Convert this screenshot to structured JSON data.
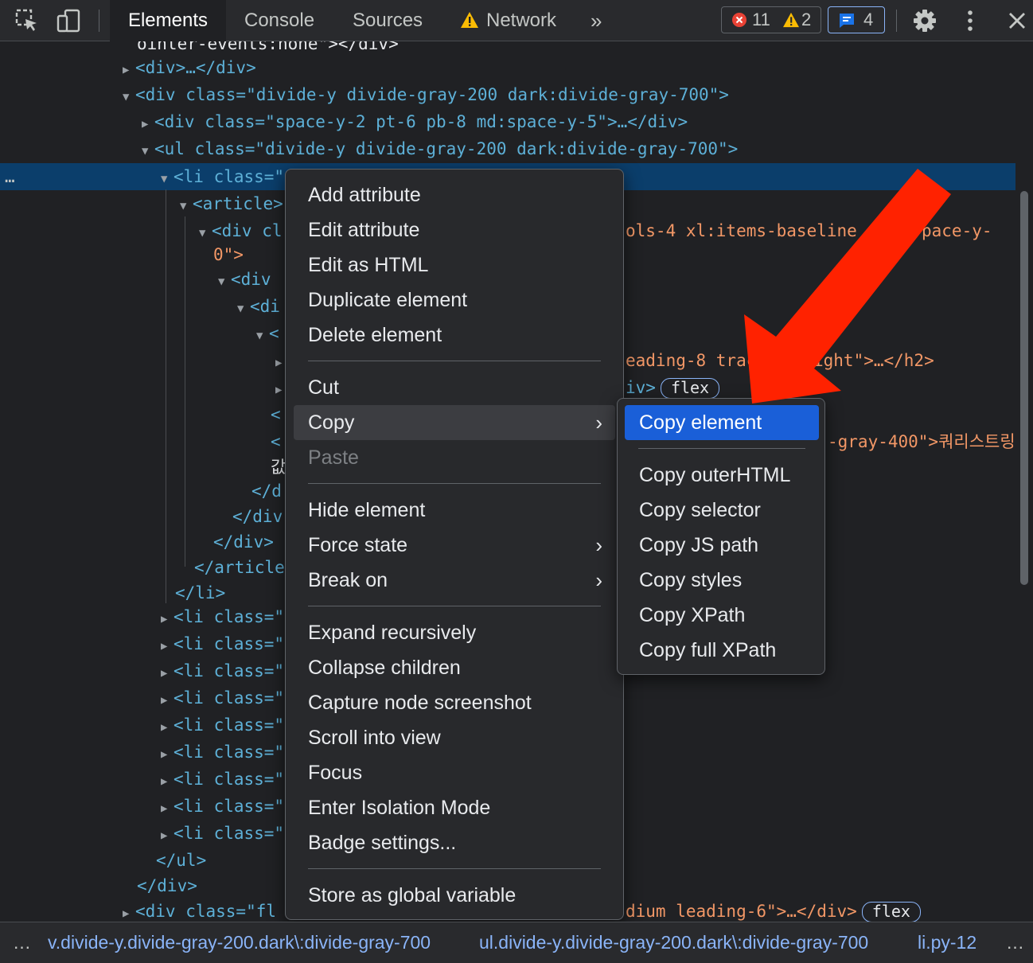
{
  "toolbar": {
    "tabs": [
      "Elements",
      "Console",
      "Sources",
      "Network"
    ],
    "more_tabs": "»",
    "errors": "11",
    "warnings": "2",
    "messages": "4"
  },
  "tree": {
    "lines": [
      {
        "t": "ointer-events:none\"></div>"
      },
      {
        "t": "<div>…</div>"
      },
      {
        "t": "<div class=\"divide-y divide-gray-200 dark:divide-gray-700\">"
      },
      {
        "t": "<div class=\"space-y-2 pt-6 pb-8 md:space-y-5\">…</div>"
      },
      {
        "t": "<ul class=\"divide-y divide-gray-200 dark:divide-gray-700\">"
      },
      {
        "t": "<li class=\""
      },
      {
        "t": "<article>"
      },
      {
        "t": "<div cl"
      },
      {
        "t": "ols-4 xl:items-baseline"
      },
      {
        "t": "pace-y-"
      },
      {
        "t": "0\">"
      },
      {
        "t": "<div"
      },
      {
        "t": "<di"
      },
      {
        "t": "<"
      },
      {
        "t": "eading-8 trac"
      },
      {
        "t": "ight\">…</h2>"
      },
      {
        "t": "iv>"
      },
      {
        "t": "flex"
      },
      {
        "t": "<"
      },
      {
        "t": "<"
      },
      {
        "t": "-gray-400\">쿼리스트링"
      },
      {
        "t": "값"
      },
      {
        "t": "</d"
      },
      {
        "t": "</div"
      },
      {
        "t": "</div>"
      },
      {
        "t": "</article"
      },
      {
        "t": "</li>"
      },
      {
        "t": "<li class=\""
      },
      {
        "t": "</ul>"
      },
      {
        "t": "</div>"
      },
      {
        "t": "<div class=\"fl"
      },
      {
        "t": "dium leading-6\">…</div>"
      },
      {
        "t": "flex"
      }
    ],
    "row_dots": "…"
  },
  "context_menu": {
    "items": [
      "Add attribute",
      "Edit attribute",
      "Edit as HTML",
      "Duplicate element",
      "Delete element",
      "Cut",
      "Copy",
      "Paste",
      "Hide element",
      "Force state",
      "Break on",
      "Expand recursively",
      "Collapse children",
      "Capture node screenshot",
      "Scroll into view",
      "Focus",
      "Enter Isolation Mode",
      "Badge settings...",
      "Store as global variable"
    ]
  },
  "copy_submenu": {
    "items": [
      "Copy element",
      "Copy outerHTML",
      "Copy selector",
      "Copy JS path",
      "Copy styles",
      "Copy XPath",
      "Copy full XPath"
    ]
  },
  "breadcrumb": {
    "left_more": "…",
    "items": [
      "v.divide-y.divide-gray-200.dark\\:divide-gray-700",
      "ul.divide-y.divide-gray-200.dark\\:divide-gray-700",
      "li.py-12"
    ],
    "right_more": "…"
  },
  "colors": {
    "arrow": "#ff2200",
    "selection": "#1a5fd8",
    "row_selection": "#0b3e6b"
  }
}
